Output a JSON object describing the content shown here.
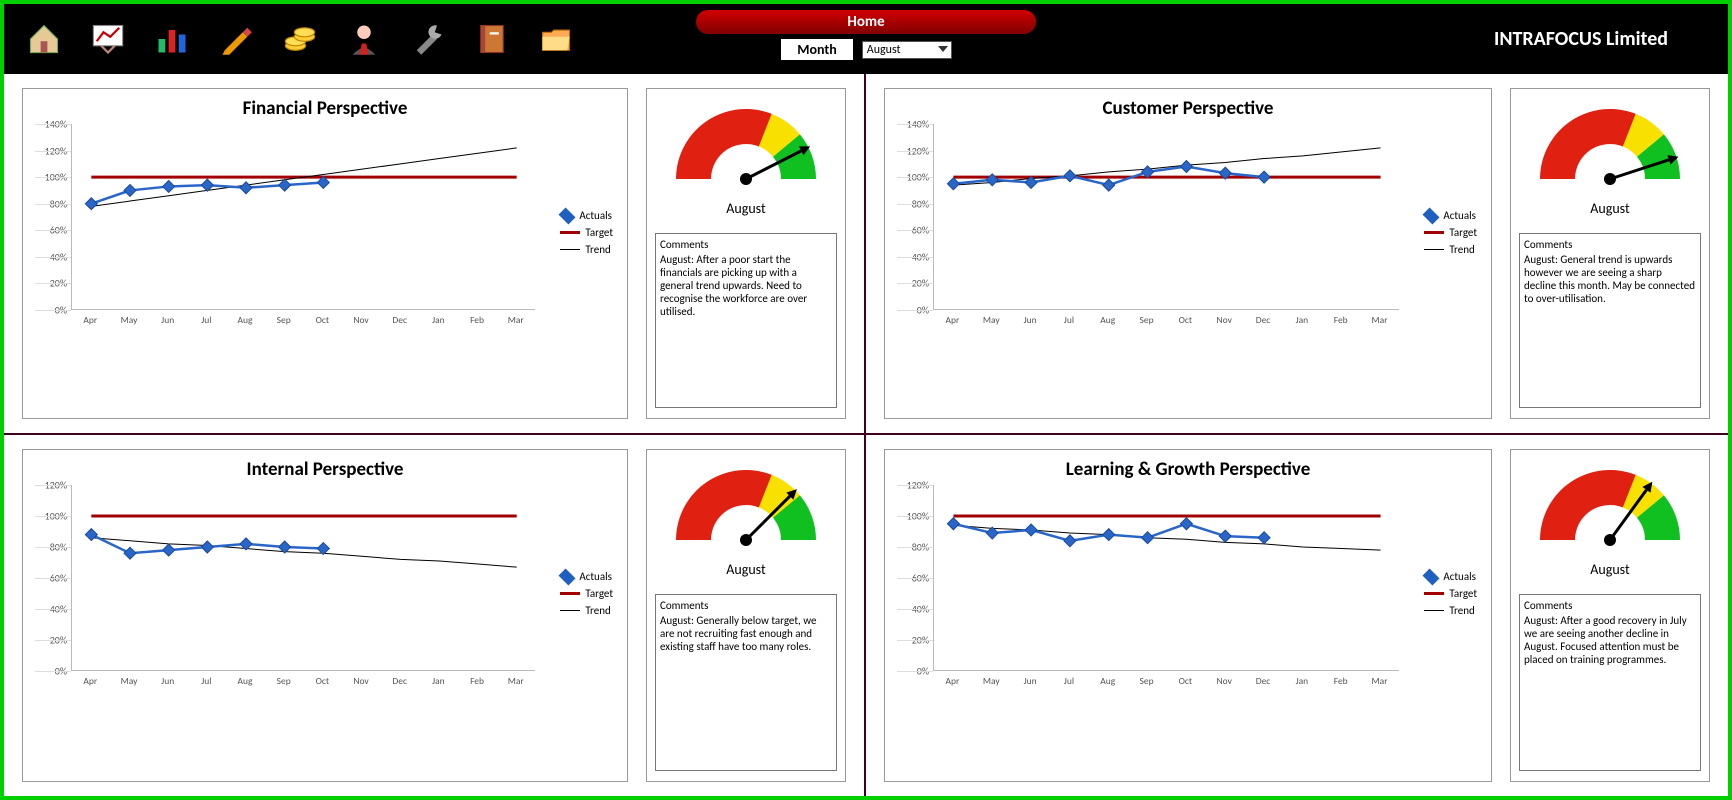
{
  "header": {
    "home_label": "Home",
    "month_label": "Month",
    "month_value": "August",
    "company": "INTRAFOCUS Limited",
    "icons": [
      "home-icon",
      "chart-board-icon",
      "bar-chart-icon",
      "pencil-icon",
      "coins-icon",
      "person-icon",
      "tools-icon",
      "notebook-icon",
      "folder-icon"
    ]
  },
  "months": [
    "Apr",
    "May",
    "Jun",
    "Jul",
    "Aug",
    "Sep",
    "Oct",
    "Nov",
    "Dec",
    "Jan",
    "Feb",
    "Mar"
  ],
  "legend": {
    "actuals": "Actuals",
    "target": "Target",
    "trend": "Trend"
  },
  "perspectives": [
    {
      "title": "Financial Perspective",
      "gauge_label": "August",
      "comments_header": "Comments",
      "comments": "August: After a poor start the financials are picking up with a general trend upwards.  Need to recognise the workforce are over utilised.",
      "ylim": [
        0,
        140
      ],
      "ystep": 20,
      "actuals": [
        80,
        90,
        93,
        94,
        92,
        94,
        96
      ],
      "target_value": 100,
      "trend": [
        78,
        82,
        86,
        90,
        94,
        98,
        102,
        106,
        110,
        114,
        118,
        122
      ],
      "gauge_needle_pct": 85
    },
    {
      "title": "Customer Perspective",
      "gauge_label": "August",
      "comments_header": "Comments",
      "comments": "August: General trend is upwards however we are seeing a sharp decline this month.  May be connected to over-utilisation.",
      "ylim": [
        0,
        140
      ],
      "ystep": 20,
      "actuals": [
        95,
        98,
        96,
        101,
        94,
        104,
        108,
        103,
        100
      ],
      "target_value": 100,
      "trend": [
        94,
        96,
        99,
        101,
        104,
        106,
        109,
        111,
        114,
        116,
        119,
        122
      ],
      "gauge_needle_pct": 90
    },
    {
      "title": "Internal Perspective",
      "gauge_label": "August",
      "comments_header": "Comments",
      "comments": "August: Generally below target, we are not recruiting fast enough and existing staff have too many roles.",
      "ylim": [
        0,
        120
      ],
      "ystep": 20,
      "actuals": [
        88,
        76,
        78,
        80,
        82,
        80,
        79
      ],
      "target_value": 100,
      "trend": [
        86,
        84,
        82,
        81,
        79,
        77,
        76,
        74,
        72,
        71,
        69,
        67
      ],
      "gauge_needle_pct": 75
    },
    {
      "title": "Learning & Growth Perspective",
      "gauge_label": "August",
      "comments_header": "Comments",
      "comments": "August: After a good recovery in July we are seeing another decline in August.  Focused attention must be placed on training programmes.",
      "ylim": [
        0,
        120
      ],
      "ystep": 20,
      "actuals": [
        95,
        89,
        91,
        84,
        88,
        86,
        95,
        87,
        86
      ],
      "target_value": 100,
      "trend": [
        94,
        92,
        91,
        89,
        88,
        86,
        85,
        83,
        82,
        80,
        79,
        78
      ],
      "gauge_needle_pct": 70
    }
  ],
  "chart_data": [
    {
      "type": "line",
      "title": "Financial Perspective",
      "categories": [
        "Apr",
        "May",
        "Jun",
        "Jul",
        "Aug",
        "Sep",
        "Oct",
        "Nov",
        "Dec",
        "Jan",
        "Feb",
        "Mar"
      ],
      "series": [
        {
          "name": "Actuals",
          "values": [
            80,
            90,
            93,
            94,
            92,
            94,
            96,
            null,
            null,
            null,
            null,
            null
          ]
        },
        {
          "name": "Target",
          "values": [
            100,
            100,
            100,
            100,
            100,
            100,
            100,
            100,
            100,
            100,
            100,
            100
          ]
        },
        {
          "name": "Trend",
          "values": [
            78,
            82,
            86,
            90,
            94,
            98,
            102,
            106,
            110,
            114,
            118,
            122
          ]
        }
      ],
      "ylabel": "%",
      "ylim": [
        0,
        140
      ]
    },
    {
      "type": "line",
      "title": "Customer Perspective",
      "categories": [
        "Apr",
        "May",
        "Jun",
        "Jul",
        "Aug",
        "Sep",
        "Oct",
        "Nov",
        "Dec",
        "Jan",
        "Feb",
        "Mar"
      ],
      "series": [
        {
          "name": "Actuals",
          "values": [
            95,
            98,
            96,
            101,
            94,
            104,
            108,
            103,
            100,
            null,
            null,
            null
          ]
        },
        {
          "name": "Target",
          "values": [
            100,
            100,
            100,
            100,
            100,
            100,
            100,
            100,
            100,
            100,
            100,
            100
          ]
        },
        {
          "name": "Trend",
          "values": [
            94,
            96,
            99,
            101,
            104,
            106,
            109,
            111,
            114,
            116,
            119,
            122
          ]
        }
      ],
      "ylabel": "%",
      "ylim": [
        0,
        140
      ]
    },
    {
      "type": "line",
      "title": "Internal Perspective",
      "categories": [
        "Apr",
        "May",
        "Jun",
        "Jul",
        "Aug",
        "Sep",
        "Oct",
        "Nov",
        "Dec",
        "Jan",
        "Feb",
        "Mar"
      ],
      "series": [
        {
          "name": "Actuals",
          "values": [
            88,
            76,
            78,
            80,
            82,
            80,
            79,
            null,
            null,
            null,
            null,
            null
          ]
        },
        {
          "name": "Target",
          "values": [
            100,
            100,
            100,
            100,
            100,
            100,
            100,
            100,
            100,
            100,
            100,
            100
          ]
        },
        {
          "name": "Trend",
          "values": [
            86,
            84,
            82,
            81,
            79,
            77,
            76,
            74,
            72,
            71,
            69,
            67
          ]
        }
      ],
      "ylabel": "%",
      "ylim": [
        0,
        120
      ]
    },
    {
      "type": "line",
      "title": "Learning & Growth Perspective",
      "categories": [
        "Apr",
        "May",
        "Jun",
        "Jul",
        "Aug",
        "Sep",
        "Oct",
        "Nov",
        "Dec",
        "Jan",
        "Feb",
        "Mar"
      ],
      "series": [
        {
          "name": "Actuals",
          "values": [
            95,
            89,
            91,
            84,
            88,
            86,
            95,
            87,
            86,
            null,
            null,
            null
          ]
        },
        {
          "name": "Target",
          "values": [
            100,
            100,
            100,
            100,
            100,
            100,
            100,
            100,
            100,
            100,
            100,
            100
          ]
        },
        {
          "name": "Trend",
          "values": [
            94,
            92,
            91,
            89,
            88,
            86,
            85,
            83,
            82,
            80,
            79,
            78
          ]
        }
      ],
      "ylabel": "%",
      "ylim": [
        0,
        120
      ]
    }
  ]
}
